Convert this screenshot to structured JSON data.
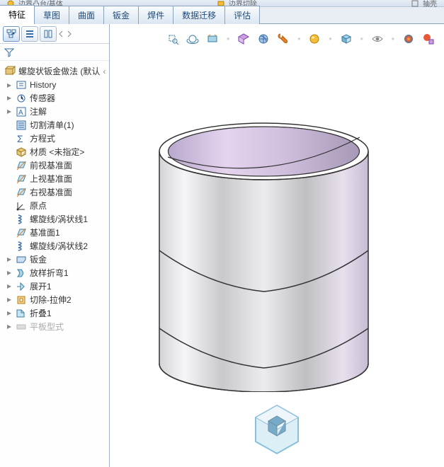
{
  "top": {
    "left_label": "边界凸台/基体",
    "right_label": "边界切除",
    "far_right": "抽壳"
  },
  "tabs": {
    "items": [
      "特征",
      "草图",
      "曲面",
      "钣金",
      "焊件",
      "数据迁移",
      "评估"
    ],
    "active_index": 0
  },
  "sidebar": {
    "root_label": "螺旋状钣金做法  (默认",
    "nodes": [
      {
        "label": "History",
        "twisty": "▸",
        "icon": "history"
      },
      {
        "label": "传感器",
        "twisty": "▸",
        "icon": "sensor"
      },
      {
        "label": "注解",
        "twisty": "▸",
        "icon": "annotate"
      },
      {
        "label": "切割清单(1)",
        "twisty": "",
        "icon": "cutlist"
      },
      {
        "label": "方程式",
        "twisty": "",
        "icon": "sigma"
      },
      {
        "label": "材质 <未指定>",
        "twisty": "",
        "icon": "material"
      },
      {
        "label": "前视基准面",
        "twisty": "",
        "icon": "plane"
      },
      {
        "label": "上视基准面",
        "twisty": "",
        "icon": "plane"
      },
      {
        "label": "右视基准面",
        "twisty": "",
        "icon": "plane"
      },
      {
        "label": "原点",
        "twisty": "",
        "icon": "origin"
      },
      {
        "label": "螺旋线/涡状线1",
        "twisty": "",
        "icon": "helix"
      },
      {
        "label": "基准面1",
        "twisty": "",
        "icon": "plane"
      },
      {
        "label": "螺旋线/涡状线2",
        "twisty": "",
        "icon": "helix"
      },
      {
        "label": "钣金",
        "twisty": "▸",
        "icon": "sheetmetal"
      },
      {
        "label": "放样折弯1",
        "twisty": "▸",
        "icon": "loftbend"
      },
      {
        "label": "展开1",
        "twisty": "▸",
        "icon": "unfold"
      },
      {
        "label": "切除-拉伸2",
        "twisty": "▸",
        "icon": "cutextrude"
      },
      {
        "label": "折叠1",
        "twisty": "▸",
        "icon": "fold"
      },
      {
        "label": "平板型式",
        "twisty": "▸",
        "icon": "flatpattern",
        "greyed": true
      }
    ]
  },
  "toolbar_icons": [
    "zoom-box",
    "zoom-rotate",
    "look-at",
    "section",
    "display-style",
    "scene",
    "appearance",
    "view-orient",
    "eye",
    "render",
    "render-settings"
  ]
}
